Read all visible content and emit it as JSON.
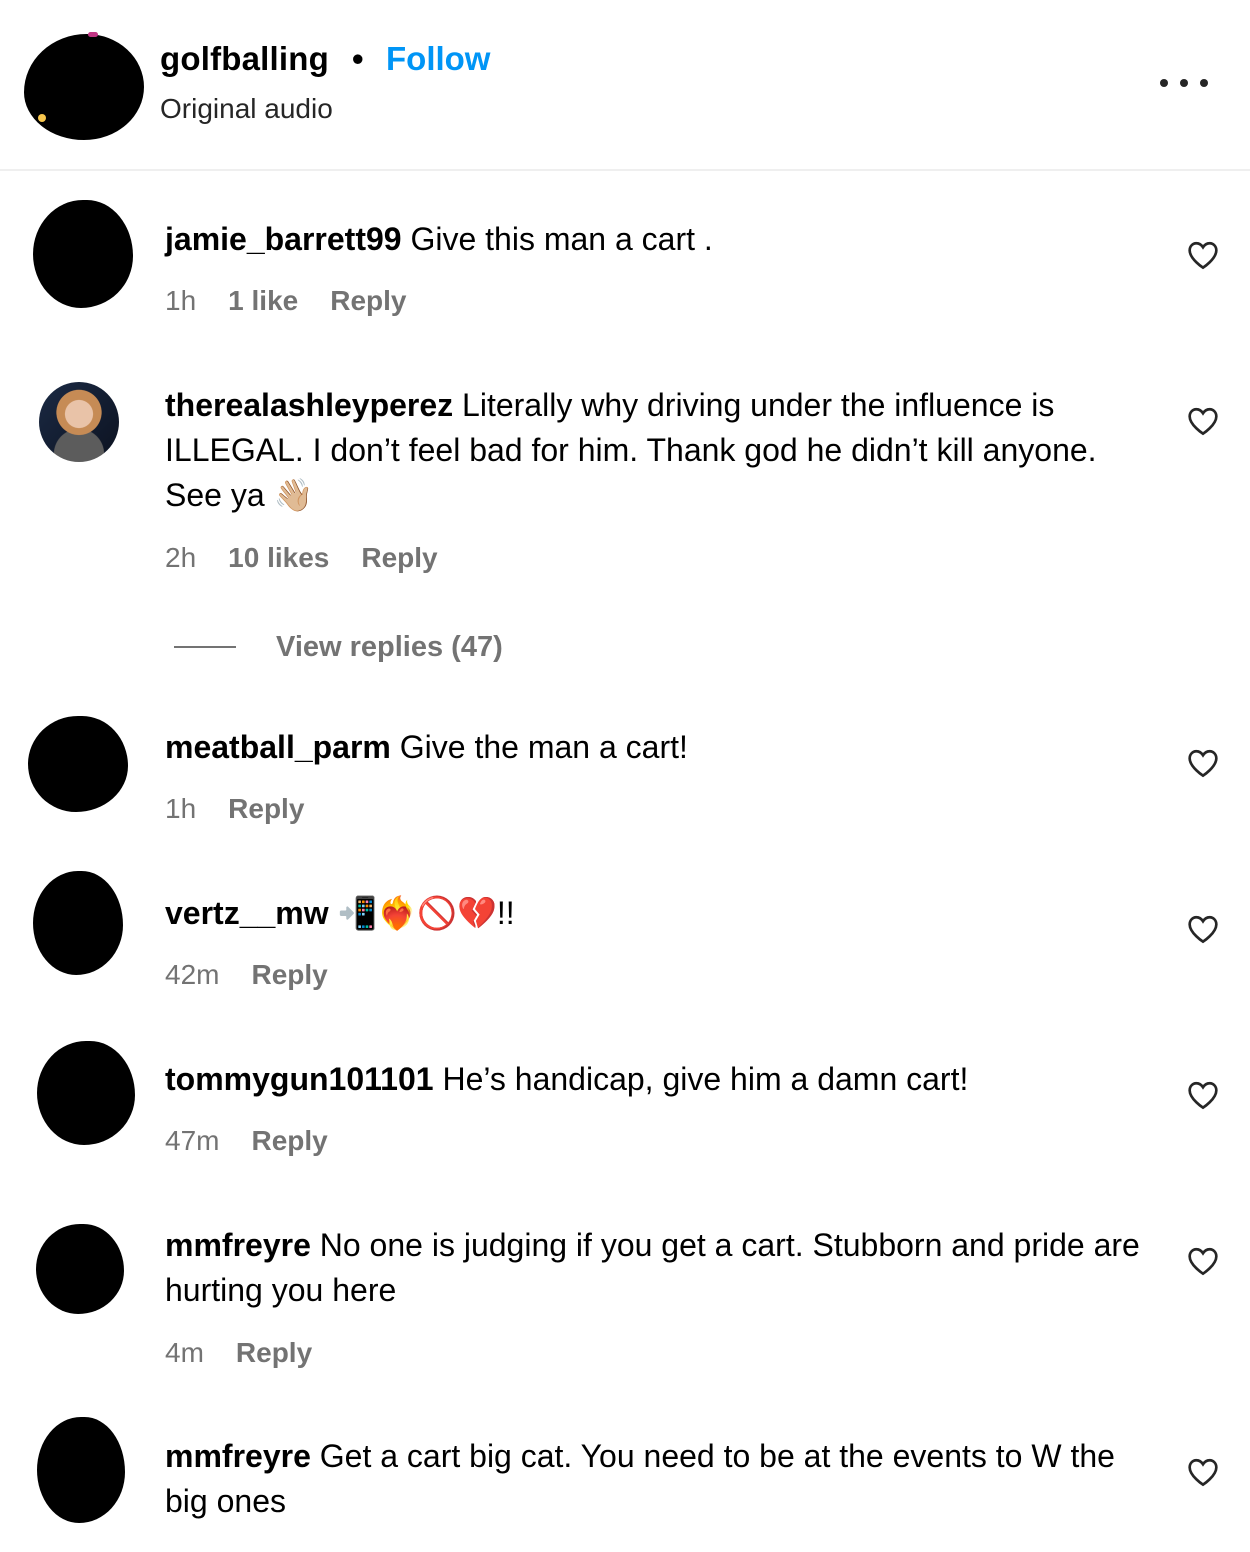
{
  "header": {
    "username": "golfballing",
    "separator": "•",
    "follow_label": "Follow",
    "subtitle": "Original audio",
    "more_icon": "more-horizontal-icon"
  },
  "comments": [
    {
      "username": "jamie_barrett99",
      "text": " Give this man a cart .",
      "time": "1h",
      "likes": "1 like",
      "reply": "Reply"
    },
    {
      "username": "therealashleyperez",
      "text": " Literally why driving under the influence is ILLEGAL. I don’t feel bad for him. Thank god he didn’t kill anyone. See ya 👋🏼",
      "time": "2h",
      "likes": "10 likes",
      "reply": "Reply",
      "view_replies": "View replies (47)"
    },
    {
      "username": "meatball_parm",
      "text": " Give the man a cart!",
      "time": "1h",
      "reply": "Reply"
    },
    {
      "username": "vertz__mw",
      "text": " 📲❤️‍🔥🚫💔!!",
      "time": "42m",
      "reply": "Reply"
    },
    {
      "username": "tommygun101101",
      "text": " He’s handicap, give him a damn cart!",
      "time": "47m",
      "reply": "Reply"
    },
    {
      "username": "mmfreyre",
      "text": " No one is judging if you get a cart. Stubborn and pride are hurting you here",
      "time": "4m",
      "reply": "Reply"
    },
    {
      "username": "mmfreyre",
      "text": " Get a cart big cat. You need to be at the events to W the big ones"
    }
  ]
}
